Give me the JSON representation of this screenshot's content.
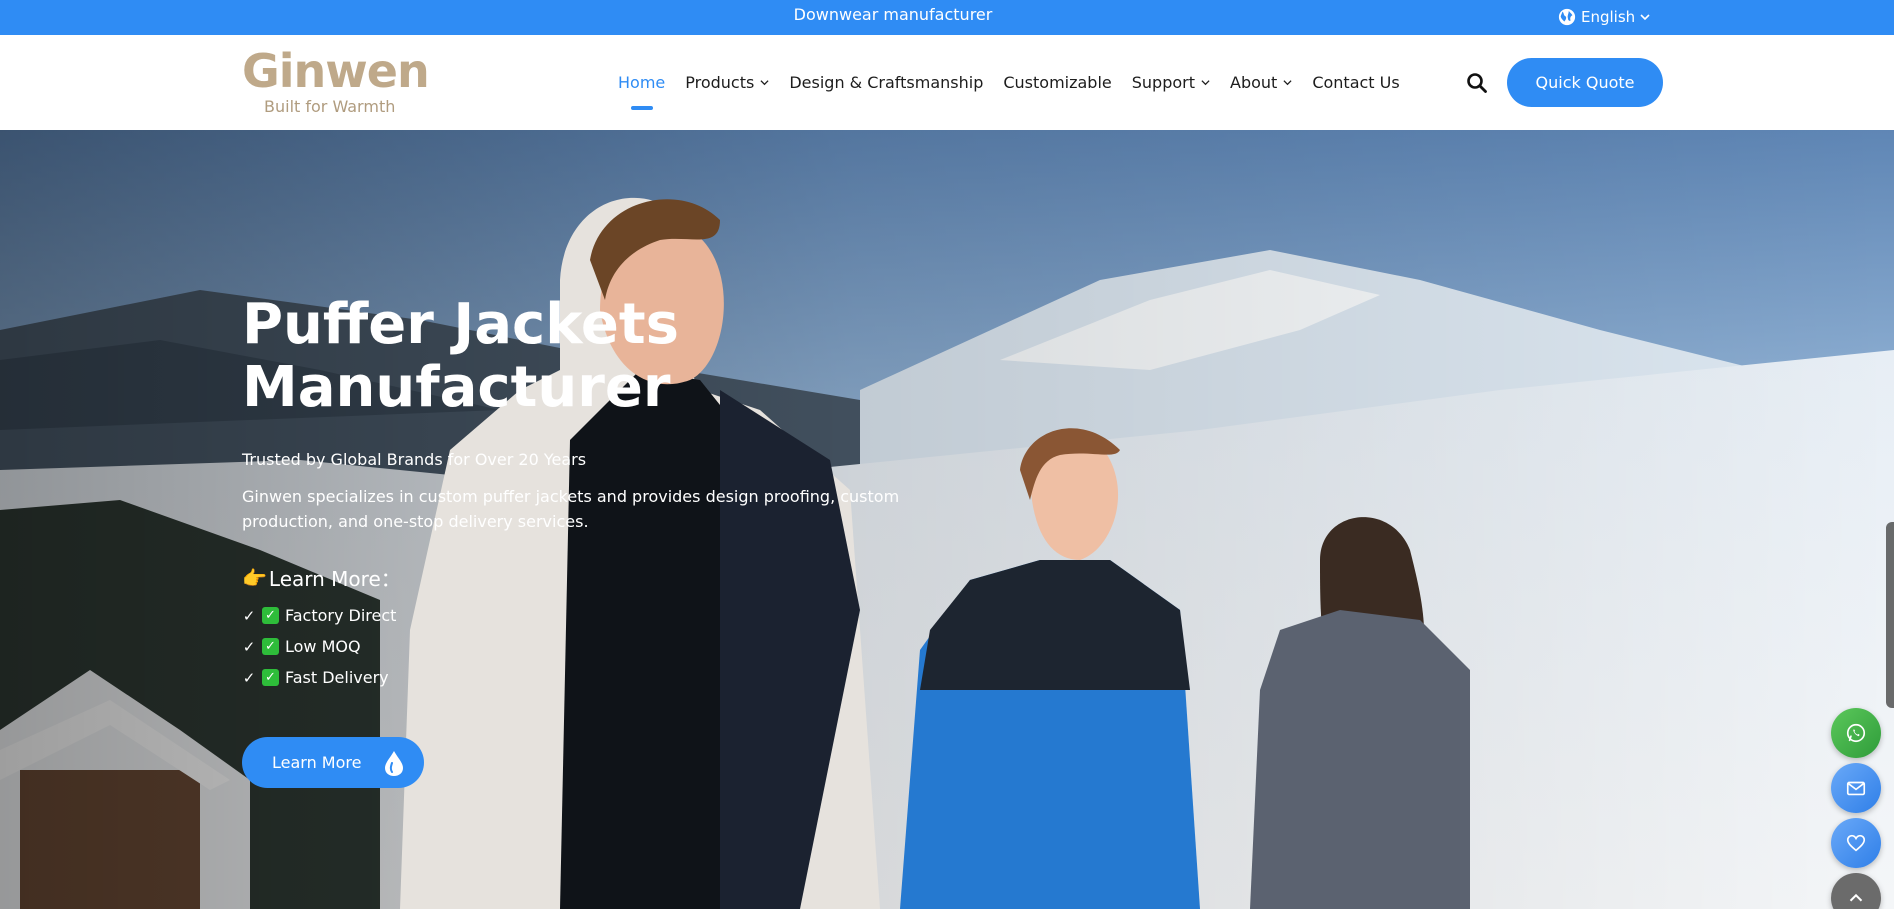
{
  "topbar": {
    "message": "Downwear manufacturer",
    "language": "English"
  },
  "header": {
    "logo_name": "Ginwen",
    "logo_tagline": "Built for Warmth",
    "nav": [
      {
        "label": "Home",
        "dropdown": false,
        "active": true
      },
      {
        "label": "Products",
        "dropdown": true,
        "active": false
      },
      {
        "label": "Design & Craftsmanship",
        "dropdown": false,
        "active": false
      },
      {
        "label": "Customizable",
        "dropdown": false,
        "active": false
      },
      {
        "label": "Support",
        "dropdown": true,
        "active": false
      },
      {
        "label": "About",
        "dropdown": true,
        "active": false
      },
      {
        "label": "Contact Us",
        "dropdown": false,
        "active": false
      }
    ],
    "search_icon": "search-icon",
    "quote_button": "Quick Quote"
  },
  "hero": {
    "title_line1": "Puffer Jackets",
    "title_line2": "Manufacturer",
    "subtitle": "Trusted by Global Brands for Over 20 Years",
    "description": "Ginwen specializes in custom puffer jackets and provides design proofing, custom production, and one-stop delivery services.",
    "learn_heading_emoji": "👉",
    "learn_heading": "Learn More：",
    "features": [
      {
        "check": "✓",
        "box": "✓",
        "label": "Factory Direct"
      },
      {
        "check": "✓",
        "box": "✓",
        "label": "Low MOQ"
      },
      {
        "check": "✓",
        "box": "✓",
        "label": "Fast Delivery"
      }
    ],
    "cta_button": "Learn More"
  },
  "floating_buttons": [
    "whatsapp-icon",
    "mail-icon",
    "heart-icon",
    "chevron-up-icon"
  ],
  "colors": {
    "accent": "#2f8cf4",
    "logo": "#bfa98a",
    "check_green": "#2ebd3a"
  }
}
